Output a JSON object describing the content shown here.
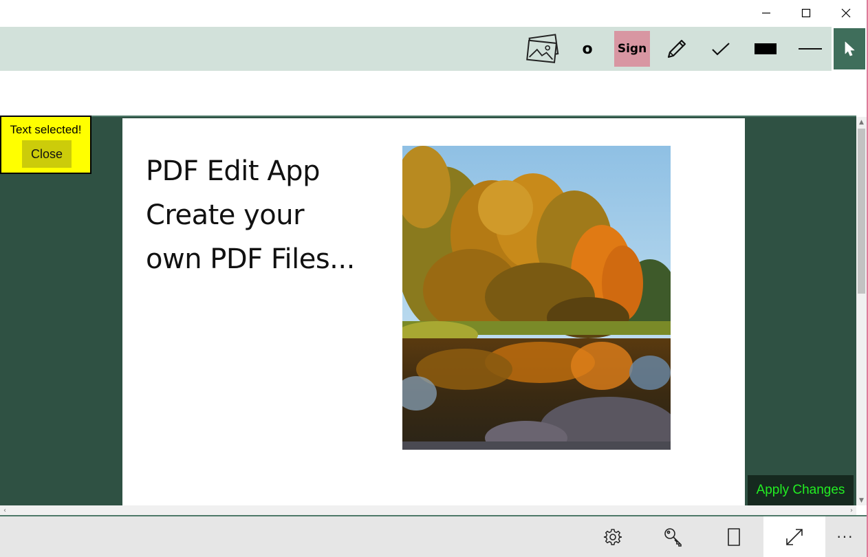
{
  "window": {
    "controls": [
      "minimize-icon",
      "maximize-icon",
      "close-icon"
    ]
  },
  "toolbar": {
    "image_tool_icon": "image-icon",
    "circle_tool_label": "o",
    "sign_button_label": "Sign",
    "sign_button_color": "#d896a2",
    "pen_tool_icon": "pencil-icon",
    "check_tool_icon": "checkmark-icon",
    "rect_tool_icon": "filled-rectangle-icon",
    "line_tool_icon": "line-icon",
    "pointer_tool_icon": "pointer-icon",
    "pointer_active_color": "#3f6e5b"
  },
  "notification": {
    "text": "Text selected!",
    "close_label": "Close",
    "background": "#ffff00"
  },
  "document": {
    "lines": [
      "PDF Edit App",
      "Create your",
      "own PDF Files..."
    ],
    "image_subject": "autumn-trees-reflected-in-lake"
  },
  "apply": {
    "label": "Apply Changes",
    "text_color": "#22ee22"
  },
  "bottom_bar": {
    "items": [
      "settings-icon",
      "key-icon",
      "page-icon",
      "fullscreen-icon"
    ],
    "more_label": "···"
  },
  "colors": {
    "workspace": "#2f5143",
    "toolbar": "#d2e1da"
  }
}
